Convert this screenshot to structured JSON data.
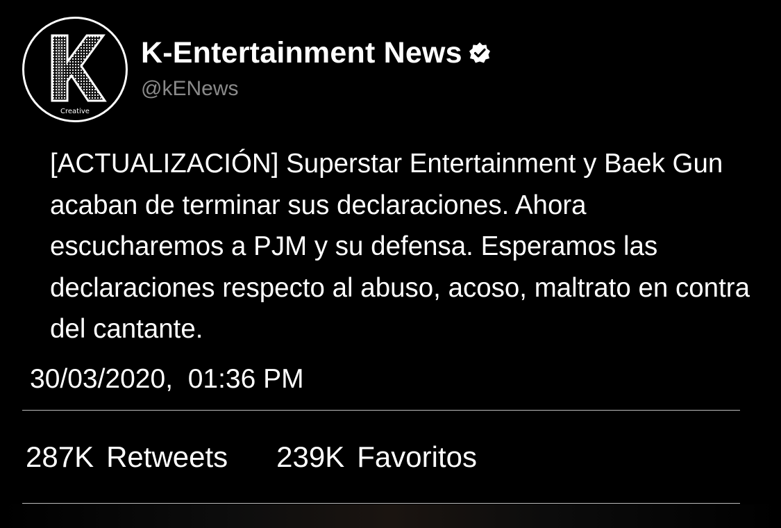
{
  "account": {
    "display_name": "K-Entertainment News",
    "handle": "@kENews",
    "avatar_letter": "K",
    "avatar_caption": "Creative",
    "verified": true
  },
  "tweet": {
    "text": "[ACTUALIZACIÓN] Superstar Entertainment y Baek Gun acaban de terminar sus declaraciones. Ahora escucharemos a PJM y su defensa. Esperamos las declaraciones respecto al abuso, acoso, maltrato en contra del cantante.",
    "timestamp": "30/03/2020,  01:36 PM"
  },
  "stats": {
    "retweets_count": "287K",
    "retweets_label": "Retweets",
    "favorites_count": "239K",
    "favorites_label": "Favoritos"
  },
  "colors": {
    "background": "#000000",
    "text": "#ffffff",
    "handle": "#8a8a8a",
    "divider": "#bdbdbd"
  }
}
